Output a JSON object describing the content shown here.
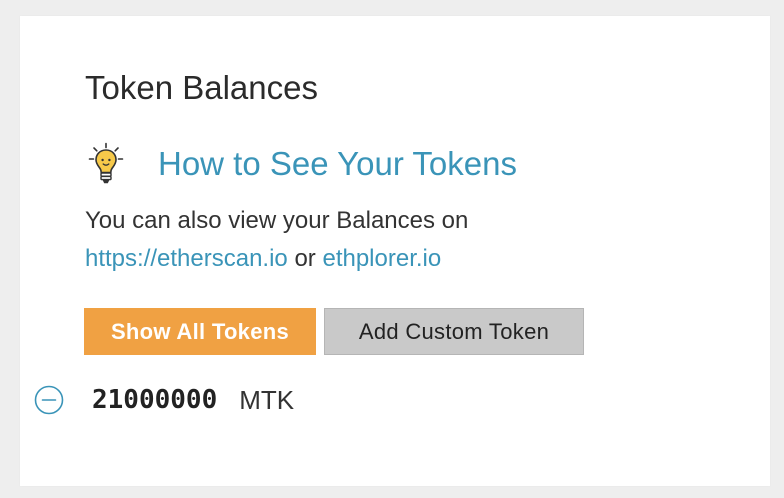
{
  "panel": {
    "title": "Token Balances",
    "help_link": "How to See Your Tokens",
    "description_text": "You can also view your Balances on",
    "etherscan_link": "https://etherscan.io",
    "or_text": "or",
    "ethplorer_link": "ethplorer.io"
  },
  "buttons": {
    "show_all": "Show All Tokens",
    "add_custom": "Add Custom Token"
  },
  "tokens": [
    {
      "amount": "21000000",
      "symbol": "MTK"
    }
  ],
  "icons": {
    "help": "lightbulb-icon",
    "remove_token": "minus-circle-icon"
  },
  "colors": {
    "link": "#3a94b8",
    "primary_button": "#f0a143",
    "secondary_button": "#c9c9c9"
  }
}
